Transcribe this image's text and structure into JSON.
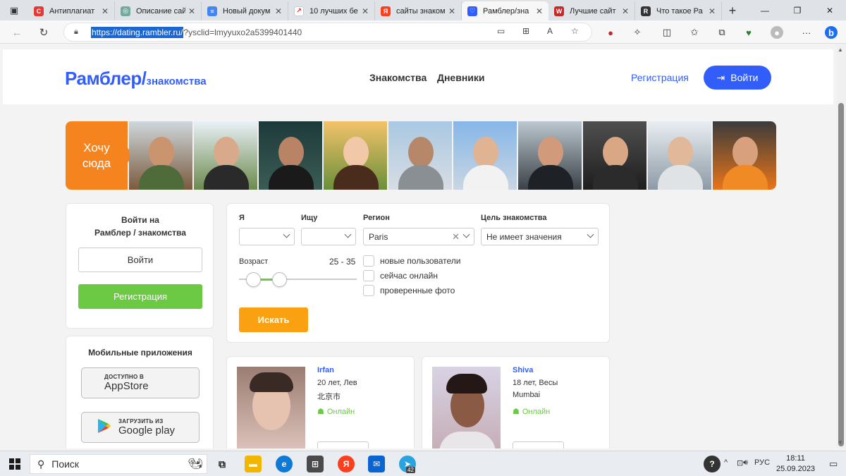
{
  "browser": {
    "tabs": [
      {
        "label": "Антиплагиат",
        "fav_color": "#e53935",
        "fav_glyph": "C"
      },
      {
        "label": "Описание сай",
        "fav_color": "#74aa9c",
        "fav_glyph": "◎"
      },
      {
        "label": "Новый докум",
        "fav_color": "#4285f4",
        "fav_glyph": "≡"
      },
      {
        "label": "10 лучших бе",
        "fav_color": "#ffffff",
        "fav_glyph": "↗"
      },
      {
        "label": "сайты знаком",
        "fav_color": "#fc3f1d",
        "fav_glyph": "Я"
      },
      {
        "label": "Рамблер/зна",
        "fav_color": "#315efb",
        "fav_glyph": "♡"
      },
      {
        "label": "Лучшие сайт",
        "fav_color": "#c62828",
        "fav_glyph": "W"
      },
      {
        "label": "Что такое Ра",
        "fav_color": "#333333",
        "fav_glyph": "R"
      }
    ],
    "active_tab": 5,
    "new_tab": "+",
    "url_selected": "https://dating.rambler.ru/",
    "url_rest": "?ysclid=lmyyuxo2a5399401440"
  },
  "site": {
    "logo_main": "Рамблер",
    "logo_slash": "/",
    "logo_sub": "знакомства",
    "nav": [
      "Знакомства",
      "Дневники"
    ],
    "register_link": "Регистрация",
    "login_button": "Войти",
    "want_here_1": "Хочу",
    "want_here_2": "сюда"
  },
  "login_card": {
    "title_1": "Войти на",
    "title_2": "Рамблер / знакомства",
    "login": "Войти",
    "register": "Регистрация"
  },
  "apps_card": {
    "title": "Мобильные приложения",
    "appstore_small": "ДОСТУПНО В",
    "appstore_big": "AppStore",
    "gplay_small": "ЗАГРУЗИТЬ ИЗ",
    "gplay_big": "Google play"
  },
  "search": {
    "label_me": "Я",
    "label_seek": "Ищу",
    "label_region": "Регион",
    "label_goal": "Цель знакомства",
    "me_value": "",
    "seek_value": "",
    "region_value": "Paris",
    "goal_value": "Не имеет значения",
    "age_label": "Возраст",
    "age_value": "25 - 35",
    "age_min": 25,
    "age_max": 35,
    "checkboxes": [
      "новые пользователи",
      "сейчас онлайн",
      "проверенные фото"
    ],
    "submit": "Искать"
  },
  "profiles": [
    {
      "name": "Irfan",
      "age": "20 лет, Лев",
      "city": "北京市",
      "status": "Онлайн"
    },
    {
      "name": "Shiva",
      "age": "18 лет, Весы",
      "city": "Mumbai",
      "status": "Онлайн"
    }
  ],
  "taskbar": {
    "search": "Поиск",
    "lang": "РУС",
    "time": "18:11",
    "date": "25.09.2023",
    "telegram_badge": "42"
  },
  "colors": {
    "brand": "#315efb",
    "green": "#6bc944",
    "orange": "#f9a110"
  }
}
